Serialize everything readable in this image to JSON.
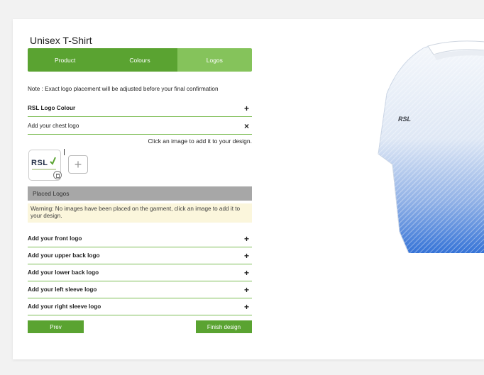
{
  "product_title": "Unisex T-Shirt",
  "tabs": [
    {
      "label": "Product"
    },
    {
      "label": "Colours"
    },
    {
      "label": "Logos"
    }
  ],
  "note": "Note : Exact logo placement will be adjusted before your final confirmation",
  "rows": {
    "logo_colour": {
      "label": "RSL Logo Colour",
      "symbol": "+"
    },
    "chest_logo": {
      "label": "Add your chest logo",
      "symbol": "×"
    }
  },
  "hint": "Click an image to add it to your design.",
  "logo_image": {
    "text": "RSL"
  },
  "add_image_symbol": "+",
  "placed_logos_label": "Placed Logos",
  "warning": "Warning: No images have been placed on the garment, click an image to add it to your design.",
  "placement_rows": [
    {
      "label": "Add your front logo",
      "symbol": "+"
    },
    {
      "label": "Add your upper back logo",
      "symbol": "+"
    },
    {
      "label": "Add your lower back logo",
      "symbol": "+"
    },
    {
      "label": "Add your left sleeve logo",
      "symbol": "+"
    },
    {
      "label": "Add your right sleeve logo",
      "symbol": "+"
    }
  ],
  "buttons": {
    "prev": "Prev",
    "finish": "Finish design"
  },
  "preview": {
    "shirt_logo_text": "RSL",
    "accent_color": "#2f6fd6"
  },
  "colors": {
    "green": "#5aa331",
    "green_light": "#85c35b"
  }
}
